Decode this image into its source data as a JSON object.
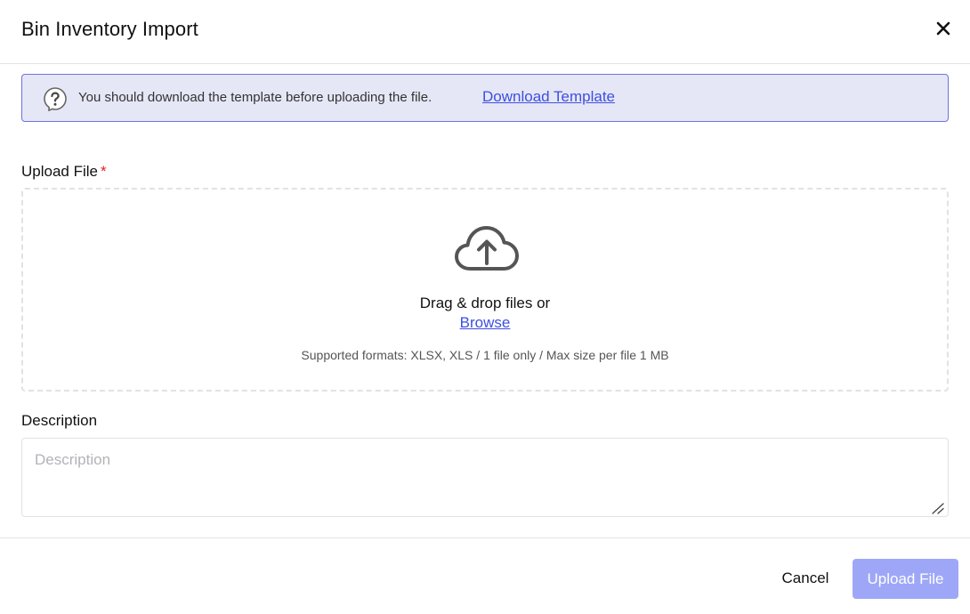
{
  "dialog": {
    "title": "Bin Inventory Import"
  },
  "notice": {
    "text": "You should download the template before uploading the file.",
    "link_label": "Download Template",
    "icon": "question-help-icon"
  },
  "upload": {
    "label": "Upload File",
    "required_marker": "*",
    "icon": "cloud-upload-icon",
    "drag_text": "Drag & drop files or",
    "browse_label": "Browse",
    "formats_text": "Supported formats: XLSX, XLS / 1 file only / Max size per file 1 MB"
  },
  "description": {
    "label": "Description",
    "placeholder": "Description",
    "value": ""
  },
  "footer": {
    "cancel_label": "Cancel",
    "upload_label": "Upload File"
  },
  "colors": {
    "accent": "#3d4fe0",
    "upload_button_disabled": "#9ea7f7",
    "notice_background": "#e6e7f6",
    "notice_border": "#6f72e0",
    "required": "#e11d1d"
  }
}
